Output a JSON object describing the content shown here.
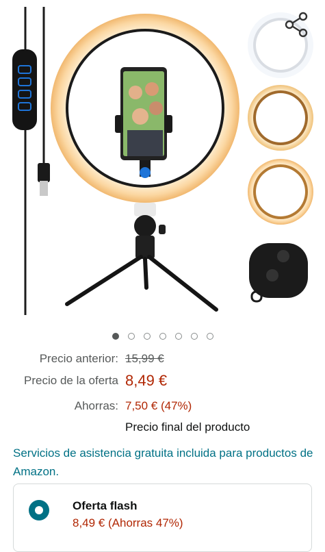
{
  "gallery": {
    "image_count": 7,
    "active_index": 0,
    "image_description_icons": [
      "ring-light-icon",
      "share-icon"
    ]
  },
  "pricing": {
    "previous_label": "Precio anterior:",
    "previous_value": "15,99 €",
    "deal_label": "Precio de la oferta",
    "deal_value": "8,49 €",
    "savings_label": "Ahorras:",
    "savings_value": "7,50 € (47%)",
    "final_note": "Precio final del producto"
  },
  "services": {
    "link_text": "Servicios de asistencia gratuita incluida para productos de Amazon."
  },
  "offer": {
    "title": "Oferta flash",
    "price": "8,49 € (Ahorras 47%)"
  },
  "colors": {
    "deal_red": "#b12704",
    "link_teal": "#007185",
    "muted": "#565959"
  }
}
